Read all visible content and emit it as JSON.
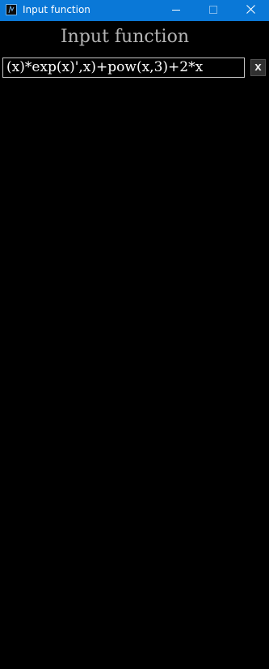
{
  "window": {
    "title": "Input function",
    "icon": "app-icon",
    "controls": {
      "minimize_icon": "minimize-icon",
      "maximize_icon": "maximize-icon",
      "close_icon": "close-icon"
    },
    "titlebar_color": "#0a78d7"
  },
  "main": {
    "heading": "Input function",
    "function_input": {
      "value": "(x)*exp(x)',x)+pow(x,3)+2*x"
    },
    "clear_button_label": "X"
  },
  "colors": {
    "background": "#000000",
    "heading": "#b4b4b4",
    "input_text": "#ffffff",
    "input_border": "#c8c8c8"
  }
}
